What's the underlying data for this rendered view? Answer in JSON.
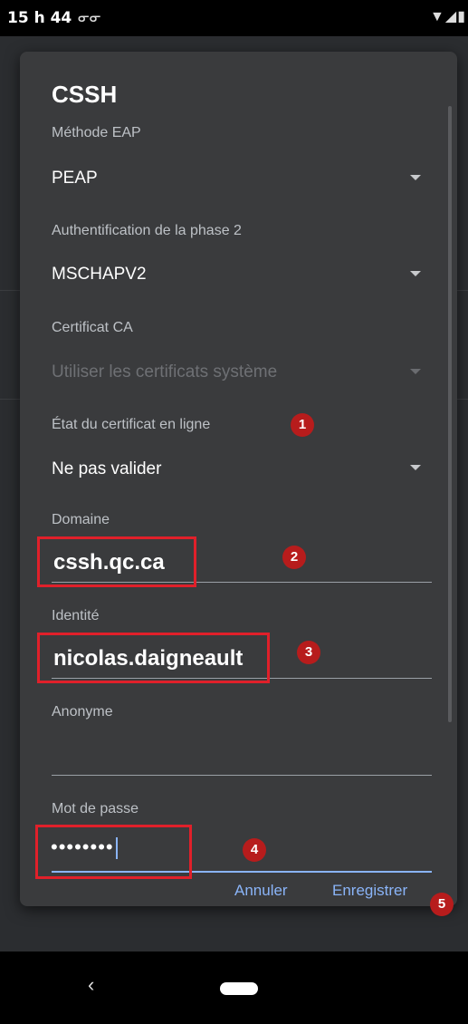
{
  "status_bar": {
    "time": "15 h 44",
    "voicemail_icon": "voicemail-icon",
    "right_icons": "▼◢▮"
  },
  "dialog": {
    "title": "CSSH",
    "eap_method": {
      "label": "Méthode EAP",
      "value": "PEAP"
    },
    "phase2": {
      "label": "Authentification de la phase 2",
      "value": "MSCHAPV2"
    },
    "ca_cert": {
      "label": "Certificat CA",
      "value": "Utiliser les certificats système"
    },
    "online_cert": {
      "label": "État du certificat en ligne",
      "value": "Ne pas valider"
    },
    "domain": {
      "label": "Domaine",
      "value": "cssh.qc.ca"
    },
    "identity": {
      "label": "Identité",
      "value": "nicolas.daigneault"
    },
    "anonymous": {
      "label": "Anonyme",
      "value": ""
    },
    "password": {
      "label": "Mot de passe",
      "value": "••••••••"
    },
    "buttons": {
      "cancel": "Annuler",
      "save": "Enregistrer"
    }
  },
  "annotations": [
    "1",
    "2",
    "3",
    "4",
    "5"
  ],
  "colors": {
    "accent": "#8ab4f8",
    "annotation_red": "#e0202a",
    "dialog_bg": "#3a3b3d"
  }
}
